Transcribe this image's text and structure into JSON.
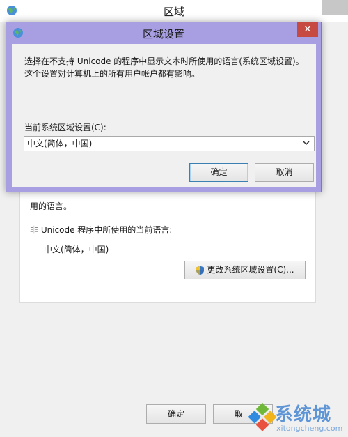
{
  "background_window": {
    "title": "区域",
    "panel": {
      "language_line": "用的语言。",
      "non_unicode_label": "非 Unicode 程序中所使用的当前语言:",
      "current_language": "中文(简体，中国)",
      "change_button": "更改系统区域设置(C)..."
    },
    "ok_button": "确定",
    "cancel_button": "取"
  },
  "dialog": {
    "title": "区域设置",
    "close_glyph": "✕",
    "description": "选择在不支持 Unicode 的程序中显示文本时所使用的语言(系统区域设置)。这个设置对计算机上的所有用户帐户都有影响。",
    "locale_label": "当前系统区域设置(C):",
    "locale_value": "中文(简体，中国)",
    "ok_button": "确定",
    "cancel_button": "取消"
  },
  "watermark": {
    "brand_cn": "系统城",
    "brand_en": "xitongcheng.com"
  },
  "colors": {
    "dialog_frame": "#a79fe2",
    "close_button": "#c74a42",
    "watermark_blue": "#5e95d6"
  }
}
